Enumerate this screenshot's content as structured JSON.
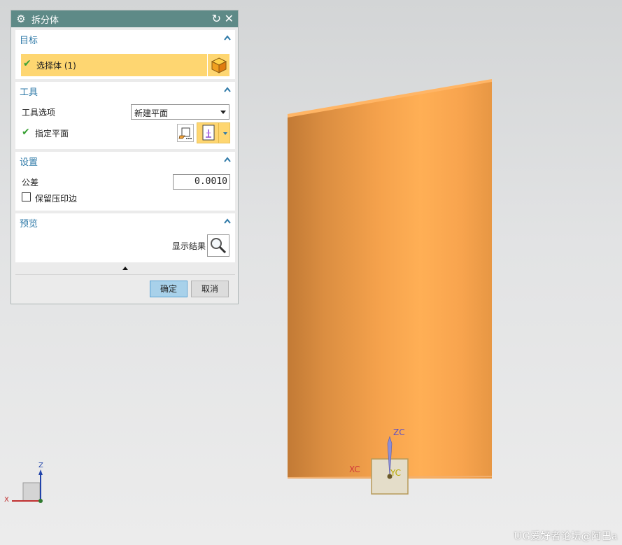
{
  "dialog": {
    "title": "拆分体",
    "target": {
      "header": "目标",
      "select_body_label": "选择体 (1)"
    },
    "tool": {
      "header": "工具",
      "tool_option_label": "工具选项",
      "tool_option_value": "新建平面",
      "specify_plane_label": "指定平面"
    },
    "settings": {
      "header": "设置",
      "tolerance_label": "公差",
      "tolerance_value": "0.0010",
      "keep_imprint_label": "保留压印边",
      "keep_imprint_checked": false
    },
    "preview": {
      "header": "预览",
      "show_result_label": "显示结果"
    },
    "ok_label": "确定",
    "cancel_label": "取消"
  },
  "viewport": {
    "csys_labels": {
      "zc": "ZC",
      "xc": "XC",
      "yc": "YC"
    },
    "triad_labels": {
      "z": "Z",
      "x": "X"
    },
    "watermark": "UG爱好者论坛@阿巴a"
  },
  "colors": {
    "title_bar": "#5e8a87",
    "section_header_text": "#2f7aa8",
    "selection_highlight": "#fed671",
    "body_orange": "#f6a54e",
    "check_green": "#3aa135",
    "ok_button": "#a8d1ea"
  }
}
